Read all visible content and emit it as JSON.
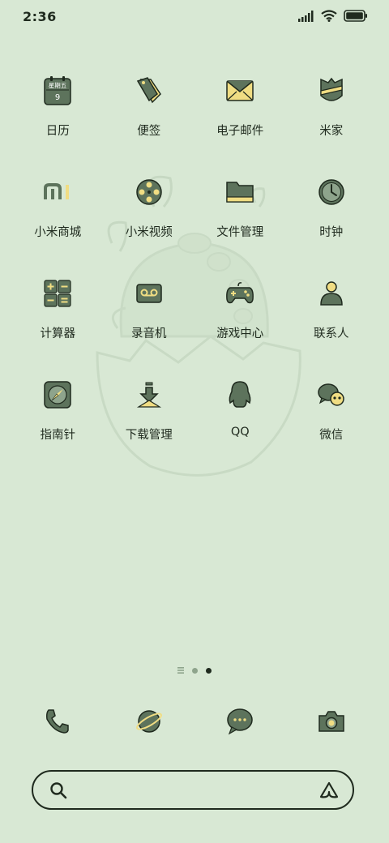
{
  "status_bar": {
    "time": "2:36"
  },
  "apps": [
    {
      "label": "日历",
      "icon": "calendar-icon",
      "sub1": "星期五",
      "sub2": "9"
    },
    {
      "label": "便签",
      "icon": "notes-icon"
    },
    {
      "label": "电子邮件",
      "icon": "mail-icon"
    },
    {
      "label": "米家",
      "icon": "mijia-icon"
    },
    {
      "label": "小米商城",
      "icon": "mi-store-icon",
      "glyph": "mi"
    },
    {
      "label": "小米视频",
      "icon": "video-reel-icon"
    },
    {
      "label": "文件管理",
      "icon": "folder-icon"
    },
    {
      "label": "时钟",
      "icon": "clock-icon"
    },
    {
      "label": "计算器",
      "icon": "calculator-icon"
    },
    {
      "label": "录音机",
      "icon": "recorder-icon"
    },
    {
      "label": "游戏中心",
      "icon": "gamepad-icon"
    },
    {
      "label": "联系人",
      "icon": "contacts-icon"
    },
    {
      "label": "指南针",
      "icon": "compass-icon"
    },
    {
      "label": "下载管理",
      "icon": "download-icon"
    },
    {
      "label": "QQ",
      "icon": "qq-icon"
    },
    {
      "label": "微信",
      "icon": "wechat-icon"
    }
  ],
  "dock": [
    {
      "icon": "phone-icon"
    },
    {
      "icon": "browser-planet-icon"
    },
    {
      "icon": "messages-icon"
    },
    {
      "icon": "camera-icon"
    }
  ],
  "search": {
    "placeholder": ""
  },
  "colors": {
    "background": "#d8e8d4",
    "icon_green": "#5d735c",
    "accent_yellow": "#f0dd83",
    "outline": "#1f2a1e"
  }
}
